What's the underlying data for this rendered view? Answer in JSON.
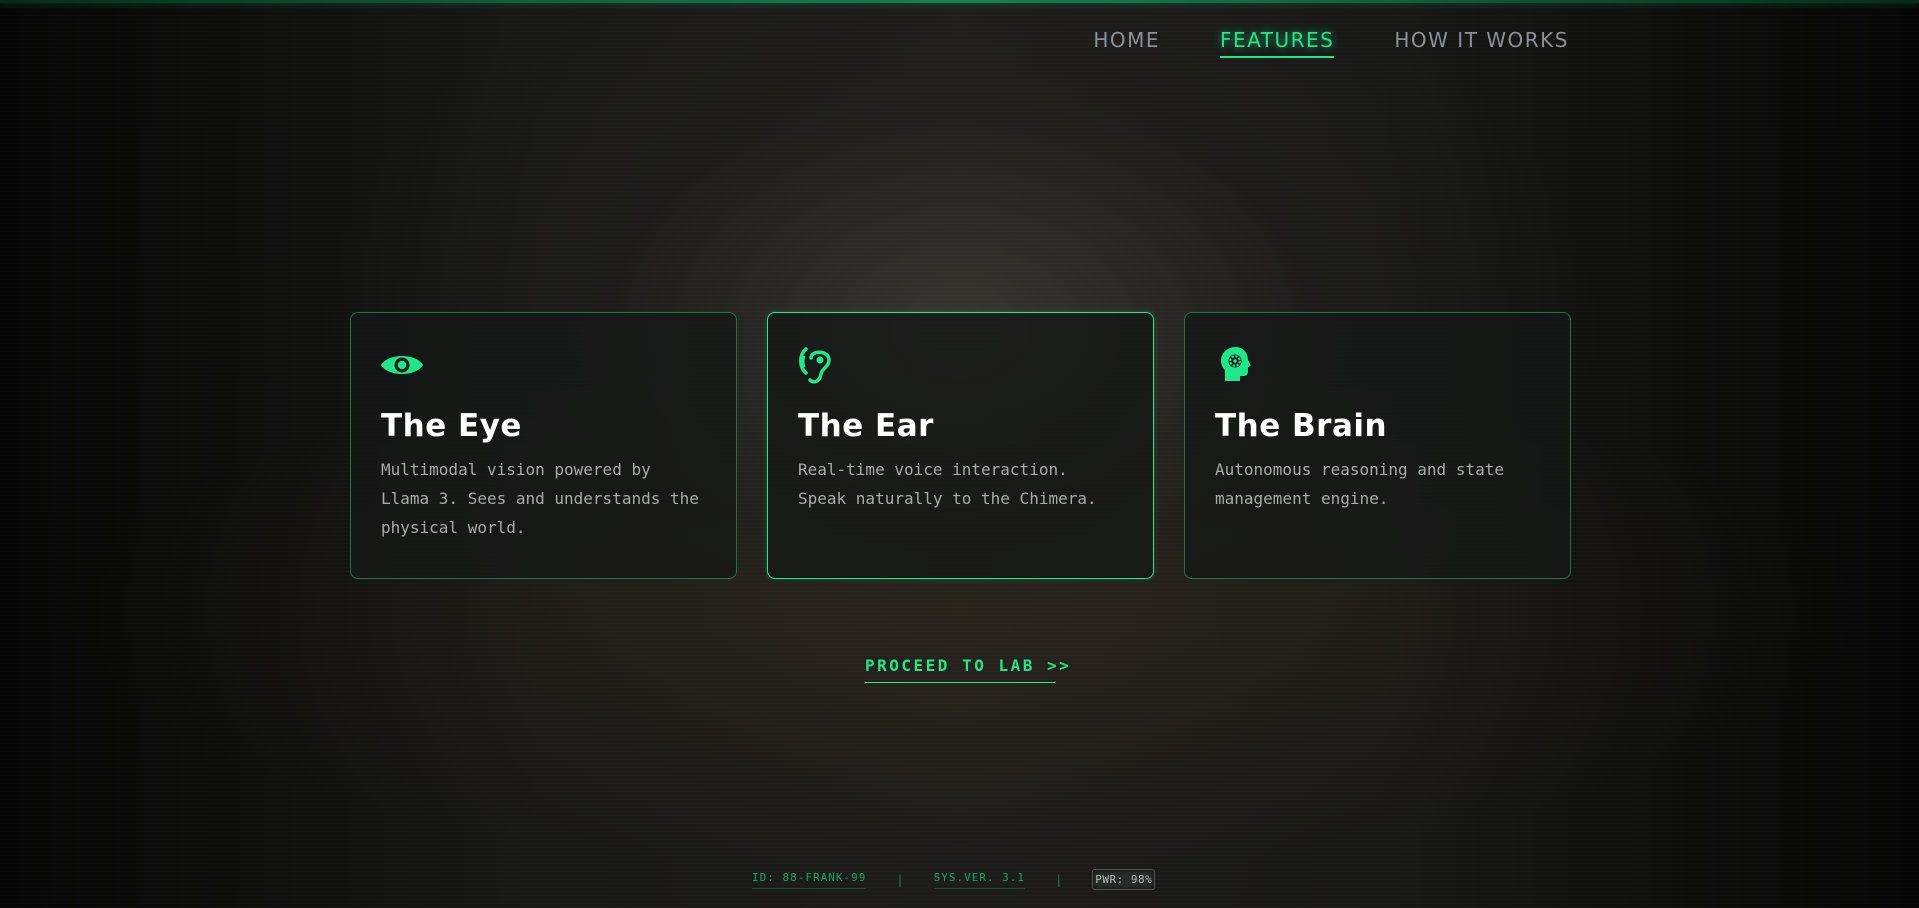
{
  "nav": {
    "items": [
      {
        "label": "HOME",
        "active": false
      },
      {
        "label": "FEATURES",
        "active": true
      },
      {
        "label": "HOW IT WORKS",
        "active": false
      }
    ]
  },
  "features": [
    {
      "icon": "eye-icon",
      "title": "The Eye",
      "description": "Multimodal vision powered by Llama 3. Sees and understands the physical world."
    },
    {
      "icon": "ear-icon",
      "title": "The Ear",
      "description": "Real-time voice interaction. Speak naturally to the Chimera."
    },
    {
      "icon": "brain-gear-head-icon",
      "title": "The Brain",
      "description": "Autonomous reasoning and state management engine."
    }
  ],
  "cta": {
    "label": "PROCEED TO LAB >>"
  },
  "status": {
    "id": "ID: 88-FRANK-99",
    "separator": "|",
    "version": "SYS.VER. 3.1",
    "power": "PWR: 98%"
  },
  "colors": {
    "accent": "#1fe88a",
    "nav_inactive": "#8b9196",
    "card_text": "#a7aca9",
    "background": "#1a1a18"
  }
}
